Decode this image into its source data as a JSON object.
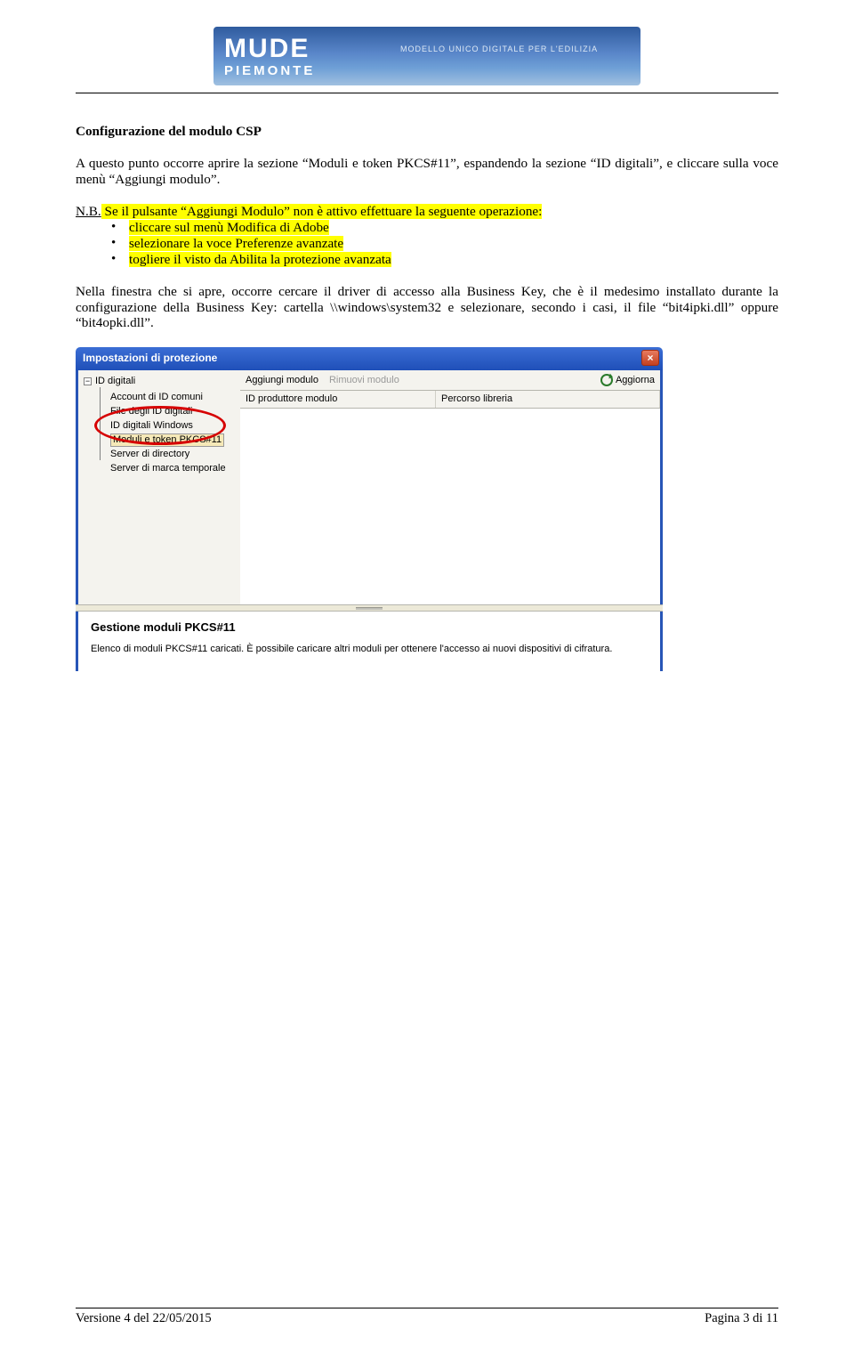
{
  "banner": {
    "brand_top": "MUDE",
    "brand_bottom": "PIEMONTE",
    "subtitle": "MODELLO UNICO DIGITALE PER L'EDILIZIA"
  },
  "doc": {
    "section_title": "Configurazione del modulo CSP",
    "para1": "A questo punto occorre aprire la sezione “Moduli e token PKCS#11”, espandendo la sezione “ID digitali”, e cliccare sulla voce menù “Aggiungi modulo”.",
    "nb_label": "N.B.",
    "nb_text": " Se il pulsante “Aggiungi Modulo” non è attivo effettuare la seguente operazione:",
    "bullets": [
      "cliccare sul menù Modifica di Adobe",
      "selezionare la voce Preferenze avanzate",
      "togliere il visto da Abilita la protezione avanzata"
    ],
    "para2": "Nella finestra che si apre, occorre cercare il driver di accesso alla Business Key, che è il medesimo installato durante la configurazione della Business Key: cartella \\\\windows\\system32 e selezionare, secondo i casi, il file “bit4ipki.dll” oppure “bit4opki.dll”."
  },
  "screenshot": {
    "window_title": "Impostazioni di protezione",
    "close_glyph": "×",
    "tree": {
      "root": "ID digitali",
      "items": [
        "Account di ID comuni",
        "File degli ID digitali",
        "ID digitali Windows",
        "Moduli e token PKCS#11",
        "Server di directory",
        "Server di marca temporale"
      ],
      "minus": "−"
    },
    "toolbar": {
      "add": "Aggiungi modulo",
      "remove": "Rimuovi modulo",
      "refresh": "Aggiorna"
    },
    "columns": {
      "c1": "ID produttore modulo",
      "c2": "Percorso libreria"
    },
    "panel": {
      "heading": "Gestione moduli PKCS#11",
      "text": "Elenco di moduli PKCS#11 caricati. È possibile caricare altri moduli per ottenere l'accesso ai nuovi dispositivi di cifratura."
    }
  },
  "footer": {
    "version": "Versione 4  del 22/05/2015",
    "page": "Pagina 3 di 11"
  }
}
